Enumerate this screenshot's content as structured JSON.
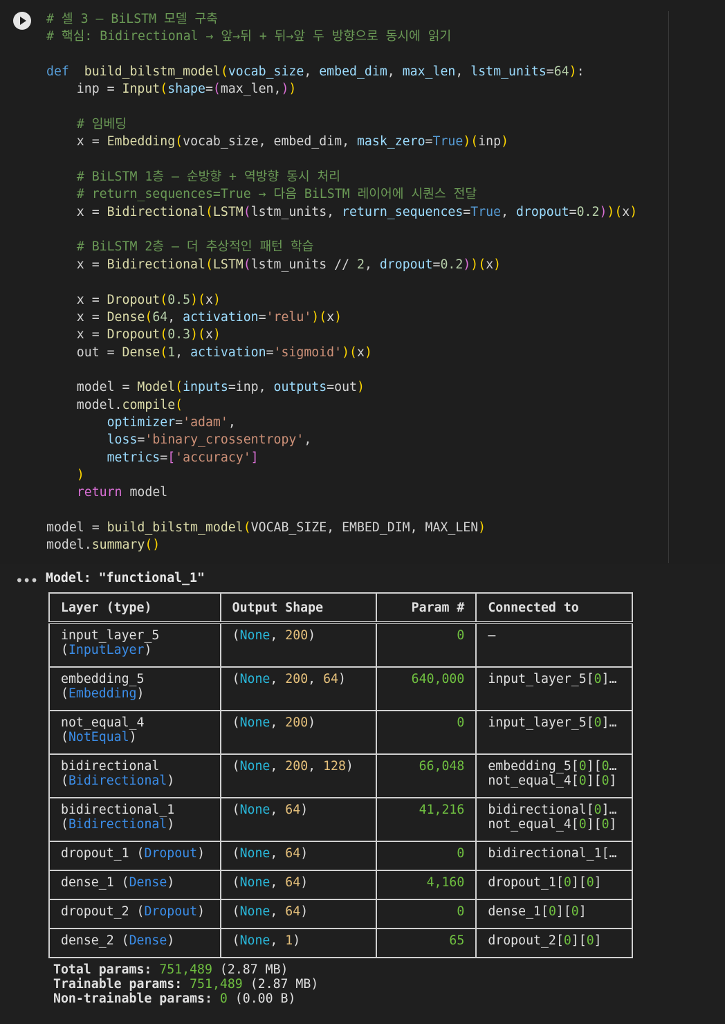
{
  "cell": {
    "code_lines": [
      [
        [
          "cm",
          "# 셀 3 — BiLSTM 모델 구축"
        ]
      ],
      [
        [
          "cm",
          "# 핵심: Bidirectional → 앞→뒤 + 뒤→앞 두 방향으로 동시에 읽기"
        ]
      ],
      [],
      [
        [
          "kw",
          "def"
        ],
        [
          "",
          "  "
        ],
        [
          "fn",
          "build_bilstm_model"
        ],
        [
          "br",
          "("
        ],
        [
          "pm",
          "vocab_size"
        ],
        [
          "",
          ", "
        ],
        [
          "pm",
          "embed_dim"
        ],
        [
          "",
          ", "
        ],
        [
          "pm",
          "max_len"
        ],
        [
          "",
          ", "
        ],
        [
          "pm",
          "lstm_units"
        ],
        [
          "",
          "="
        ],
        [
          "nu",
          "64"
        ],
        [
          "br",
          ")"
        ],
        [
          "",
          ":"
        ]
      ],
      [
        [
          "",
          "    inp = "
        ],
        [
          "fn",
          "Input"
        ],
        [
          "br",
          "("
        ],
        [
          "pm",
          "shape"
        ],
        [
          "",
          "="
        ],
        [
          "bp",
          "("
        ],
        [
          "",
          "max_len,"
        ],
        [
          "bp",
          ")"
        ],
        [
          "br",
          ")"
        ]
      ],
      [],
      [
        [
          "",
          "    "
        ],
        [
          "cm",
          "# 임베딩"
        ]
      ],
      [
        [
          "",
          "    x = "
        ],
        [
          "fn",
          "Embedding"
        ],
        [
          "br",
          "("
        ],
        [
          "",
          "vocab_size, embed_dim, "
        ],
        [
          "pm",
          "mask_zero"
        ],
        [
          "",
          "="
        ],
        [
          "kw",
          "True"
        ],
        [
          "br",
          ")"
        ],
        [
          "br",
          "("
        ],
        [
          "",
          "inp"
        ],
        [
          "br",
          ")"
        ]
      ],
      [],
      [
        [
          "",
          "    "
        ],
        [
          "cm",
          "# BiLSTM 1층 — 순방향 + 역방향 동시 처리"
        ]
      ],
      [
        [
          "",
          "    "
        ],
        [
          "cm",
          "# return_sequences=True → 다음 BiLSTM 레이어에 시퀀스 전달"
        ]
      ],
      [
        [
          "",
          "    x = "
        ],
        [
          "fn",
          "Bidirectional"
        ],
        [
          "br",
          "("
        ],
        [
          "fn",
          "LSTM"
        ],
        [
          "bp",
          "("
        ],
        [
          "",
          "lstm_units, "
        ],
        [
          "pm",
          "return_sequences"
        ],
        [
          "",
          "="
        ],
        [
          "kw",
          "True"
        ],
        [
          "",
          ", "
        ],
        [
          "pm",
          "dropout"
        ],
        [
          "",
          "="
        ],
        [
          "nu",
          "0.2"
        ],
        [
          "bp",
          ")"
        ],
        [
          "br",
          ")"
        ],
        [
          "br",
          "("
        ],
        [
          "",
          "x"
        ],
        [
          "br",
          ")"
        ]
      ],
      [],
      [
        [
          "",
          "    "
        ],
        [
          "cm",
          "# BiLSTM 2층 — 더 추상적인 패턴 학습"
        ]
      ],
      [
        [
          "",
          "    x = "
        ],
        [
          "fn",
          "Bidirectional"
        ],
        [
          "br",
          "("
        ],
        [
          "fn",
          "LSTM"
        ],
        [
          "bp",
          "("
        ],
        [
          "",
          "lstm_units // "
        ],
        [
          "nu",
          "2"
        ],
        [
          "",
          ", "
        ],
        [
          "pm",
          "dropout"
        ],
        [
          "",
          "="
        ],
        [
          "nu",
          "0.2"
        ],
        [
          "bp",
          ")"
        ],
        [
          "br",
          ")"
        ],
        [
          "br",
          "("
        ],
        [
          "",
          "x"
        ],
        [
          "br",
          ")"
        ]
      ],
      [],
      [
        [
          "",
          "    x = "
        ],
        [
          "fn",
          "Dropout"
        ],
        [
          "br",
          "("
        ],
        [
          "nu",
          "0.5"
        ],
        [
          "br",
          ")"
        ],
        [
          "br",
          "("
        ],
        [
          "",
          "x"
        ],
        [
          "br",
          ")"
        ]
      ],
      [
        [
          "",
          "    x = "
        ],
        [
          "fn",
          "Dense"
        ],
        [
          "br",
          "("
        ],
        [
          "nu",
          "64"
        ],
        [
          "",
          ", "
        ],
        [
          "pm",
          "activation"
        ],
        [
          "",
          "="
        ],
        [
          "st",
          "'relu'"
        ],
        [
          "br",
          ")"
        ],
        [
          "br",
          "("
        ],
        [
          "",
          "x"
        ],
        [
          "br",
          ")"
        ]
      ],
      [
        [
          "",
          "    x = "
        ],
        [
          "fn",
          "Dropout"
        ],
        [
          "br",
          "("
        ],
        [
          "nu",
          "0.3"
        ],
        [
          "br",
          ")"
        ],
        [
          "br",
          "("
        ],
        [
          "",
          "x"
        ],
        [
          "br",
          ")"
        ]
      ],
      [
        [
          "",
          "    out = "
        ],
        [
          "fn",
          "Dense"
        ],
        [
          "br",
          "("
        ],
        [
          "nu",
          "1"
        ],
        [
          "",
          ", "
        ],
        [
          "pm",
          "activation"
        ],
        [
          "",
          "="
        ],
        [
          "st",
          "'sigmoid'"
        ],
        [
          "br",
          ")"
        ],
        [
          "br",
          "("
        ],
        [
          "",
          "x"
        ],
        [
          "br",
          ")"
        ]
      ],
      [],
      [
        [
          "",
          "    model = "
        ],
        [
          "fn",
          "Model"
        ],
        [
          "br",
          "("
        ],
        [
          "pm",
          "inputs"
        ],
        [
          "",
          "=inp, "
        ],
        [
          "pm",
          "outputs"
        ],
        [
          "",
          "=out"
        ],
        [
          "br",
          ")"
        ]
      ],
      [
        [
          "",
          "    model."
        ],
        [
          "fn",
          "compile"
        ],
        [
          "br",
          "("
        ]
      ],
      [
        [
          "",
          "        "
        ],
        [
          "pm",
          "optimizer"
        ],
        [
          "",
          "="
        ],
        [
          "st",
          "'adam'"
        ],
        [
          "",
          ","
        ]
      ],
      [
        [
          "",
          "        "
        ],
        [
          "pm",
          "loss"
        ],
        [
          "",
          "="
        ],
        [
          "st",
          "'binary_crossentropy'"
        ],
        [
          "",
          ","
        ]
      ],
      [
        [
          "",
          "        "
        ],
        [
          "pm",
          "metrics"
        ],
        [
          "",
          "="
        ],
        [
          "bp",
          "["
        ],
        [
          "st",
          "'accuracy'"
        ],
        [
          "bp",
          "]"
        ]
      ],
      [
        [
          "",
          "    "
        ],
        [
          "br",
          ")"
        ]
      ],
      [
        [
          "",
          "    "
        ],
        [
          "bp",
          "return"
        ],
        [
          "",
          " model"
        ]
      ],
      [],
      [
        [
          "",
          "model = "
        ],
        [
          "fn",
          "build_bilstm_model"
        ],
        [
          "br",
          "("
        ],
        [
          "",
          "VOCAB_SIZE, EMBED_DIM, MAX_LEN"
        ],
        [
          "br",
          ")"
        ]
      ],
      [
        [
          "",
          "model."
        ],
        [
          "fn",
          "summary"
        ],
        [
          "br",
          "()"
        ]
      ]
    ]
  },
  "output": {
    "more_icon": "•••",
    "title_label": "Model: ",
    "title_value": "\"functional_1\"",
    "headers": {
      "layer": "Layer (type)",
      "shape": "Output Shape",
      "param": "Param #",
      "connected": "Connected to"
    },
    "rows": [
      {
        "name": "input_layer_5",
        "type": "InputLayer",
        "shape": [
          "200"
        ],
        "param": "0",
        "connected": [
          [
            "–"
          ]
        ]
      },
      {
        "name": "embedding_5",
        "type": "Embedding",
        "shape": [
          "200",
          "64"
        ],
        "param": "640,000",
        "connected": [
          [
            "input_layer_5",
            "0",
            "…"
          ]
        ]
      },
      {
        "name": "not_equal_4",
        "type": "NotEqual",
        "shape": [
          "200"
        ],
        "param": "0",
        "connected": [
          [
            "input_layer_5",
            "0",
            "…"
          ]
        ]
      },
      {
        "name": "bidirectional",
        "type": "Bidirectional",
        "shape": [
          "200",
          "128"
        ],
        "param": "66,048",
        "connected": [
          [
            "embedding_5",
            "0",
            "0…"
          ],
          [
            "not_equal_4",
            "0",
            "0"
          ]
        ]
      },
      {
        "name": "bidirectional_1",
        "type": "Bidirectional",
        "shape": [
          "64"
        ],
        "param": "41,216",
        "connected": [
          [
            "bidirectional",
            "0",
            "…"
          ],
          [
            "not_equal_4",
            "0",
            "0"
          ]
        ]
      },
      {
        "name": "dropout_1",
        "type": "Dropout",
        "inline": true,
        "shape": [
          "64"
        ],
        "param": "0",
        "connected": [
          [
            "bidirectional_1",
            "",
            "…"
          ]
        ]
      },
      {
        "name": "dense_1",
        "type": "Dense",
        "inline": true,
        "shape": [
          "64"
        ],
        "param": "4,160",
        "connected": [
          [
            "dropout_1",
            "0",
            "0"
          ]
        ]
      },
      {
        "name": "dropout_2",
        "type": "Dropout",
        "inline": true,
        "shape": [
          "64"
        ],
        "param": "0",
        "connected": [
          [
            "dense_1",
            "0",
            "0"
          ]
        ]
      },
      {
        "name": "dense_2",
        "type": "Dense",
        "inline": true,
        "shape": [
          "1"
        ],
        "param": "65",
        "connected": [
          [
            "dropout_2",
            "0",
            "0"
          ]
        ]
      }
    ],
    "none_label": "None",
    "totals": {
      "total_label": "Total params: ",
      "total_value": "751,489",
      "total_size": " (2.87 MB)",
      "trainable_label": "Trainable params: ",
      "trainable_value": "751,489",
      "trainable_size": " (2.87 MB)",
      "nontrainable_label": "Non-trainable params: ",
      "nontrainable_value": "0",
      "nontrainable_size": " (0.00 B)"
    }
  }
}
